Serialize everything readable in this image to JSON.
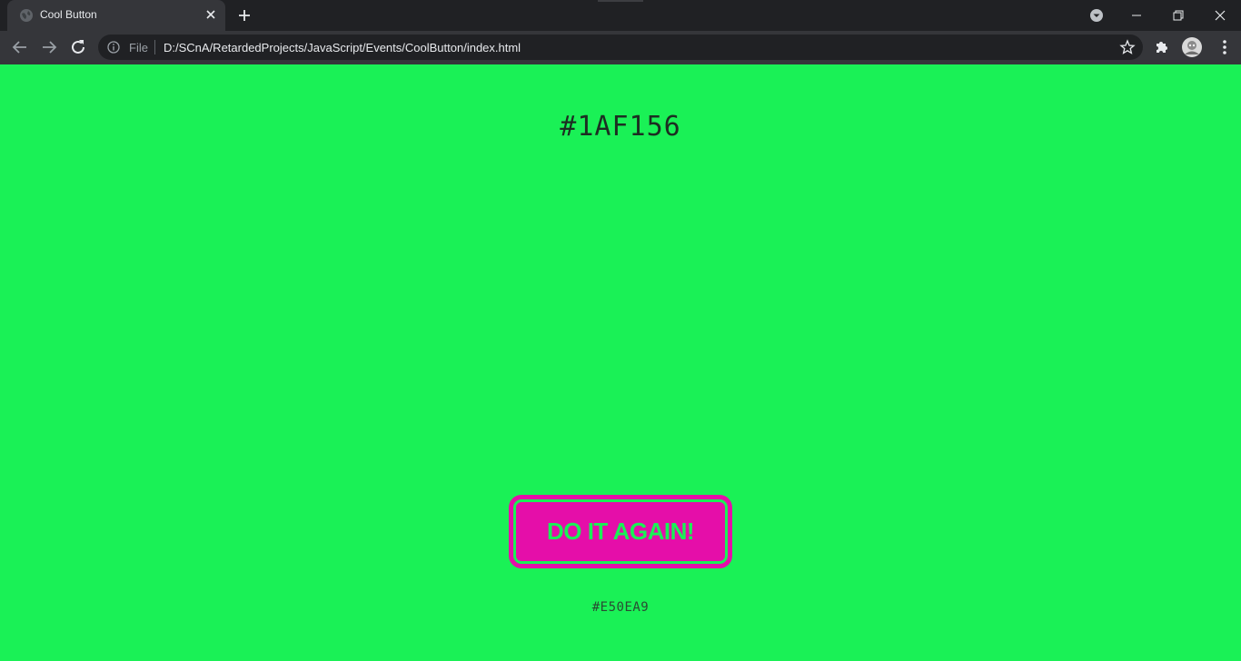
{
  "browser": {
    "tab": {
      "title": "Cool Button",
      "favicon_icon": "globe-icon"
    },
    "omnibox": {
      "scheme": "File",
      "url": "D:/SCnA/RetardedProjects/JavaScript/Events/CoolButton/index.html"
    },
    "icons": {
      "back": "arrow-left-icon",
      "forward": "arrow-right-icon",
      "reload": "reload-icon",
      "bookmark": "star-icon",
      "extensions": "puzzle-icon",
      "profile": "avatar",
      "tab_search": "chevron-down-icon",
      "minimize": "minimize-icon",
      "restore": "restore-icon",
      "close": "close-icon"
    },
    "colors": {
      "tab_strip": "#202124",
      "toolbar": "#35363a"
    }
  },
  "page": {
    "background_color": "#1AF156",
    "heading": "#1AF156",
    "button": {
      "label": "DO IT AGAIN!",
      "color": "#E50EA9"
    },
    "button_color_text": "#E50EA9"
  }
}
